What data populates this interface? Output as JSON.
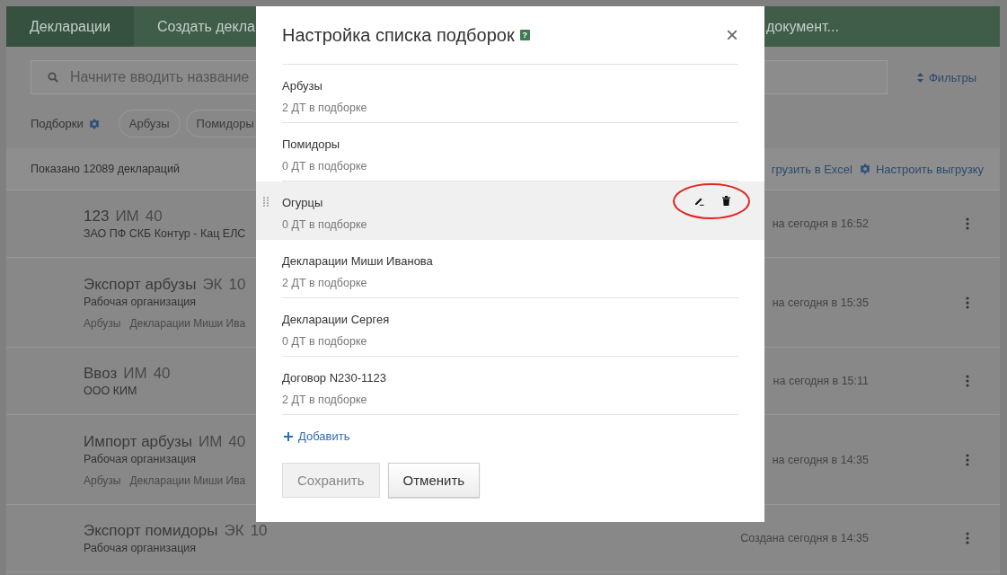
{
  "nav": {
    "tabs": [
      {
        "label": "Декларации",
        "selected": true
      },
      {
        "label": "Создать декла",
        "selected": false
      },
      {
        "label": "документ...",
        "selected": false
      }
    ]
  },
  "search": {
    "placeholder": "Начните вводить название"
  },
  "filters_link": "Фильтры",
  "collections": {
    "label": "Подборки",
    "chips": [
      "Арбузы",
      "Помидоры"
    ]
  },
  "summary": {
    "count": "Показано 12089 деклараций",
    "export": "грузить в Excel",
    "configure_export": "Настроить выгрузку"
  },
  "declarations": [
    {
      "title": "123",
      "type": "ИМ",
      "code": "40",
      "org": "ЗАО ПФ СКБ Контур - Кац ЕЛС",
      "created": "на сегодня в 16:52"
    },
    {
      "title": "Экспорт арбузы",
      "type": "ЭК",
      "code": "10",
      "org": "Рабочая организация",
      "tags": [
        "Арбузы",
        "Декларации Миши Ива"
      ],
      "created": "на сегодня в 15:35"
    },
    {
      "title": "Ввоз",
      "type": "ИМ",
      "code": "40",
      "org": "ООО КИМ",
      "created": "на сегодня в 15:11"
    },
    {
      "title": "Импорт арбузы",
      "type": "ИМ",
      "code": "40",
      "org": "Рабочая организация",
      "tags": [
        "Арбузы",
        "Декларации Миши Ива"
      ],
      "created": "на сегодня в 14:35"
    },
    {
      "title": "Экспорт помидоры",
      "type": "ЭК",
      "code": "10",
      "org": "Рабочая организация",
      "created": "Создана сегодня в 14:35"
    }
  ],
  "dialog": {
    "title": "Настройка списка подборок",
    "help": "?",
    "close": "×",
    "items": [
      {
        "name": "Арбузы",
        "count": "2 ДТ в подборке",
        "hovered": false
      },
      {
        "name": "Помидоры",
        "count": "0 ДТ в подборке",
        "hovered": false
      },
      {
        "name": "Огурцы",
        "count": "0 ДТ в подборке",
        "hovered": true
      },
      {
        "name": "Декларации Миши Иванова",
        "count": "2 ДТ в подборке",
        "hovered": false
      },
      {
        "name": "Декларации Сергея",
        "count": "0 ДТ в подборке",
        "hovered": false
      },
      {
        "name": "Договор N230-1123",
        "count": "2 ДТ в подборке",
        "hovered": false
      }
    ],
    "add": "Добавить",
    "buttons": [
      {
        "label": "Сохранить",
        "disabled": true
      },
      {
        "label": "Отменить",
        "disabled": false
      }
    ]
  }
}
